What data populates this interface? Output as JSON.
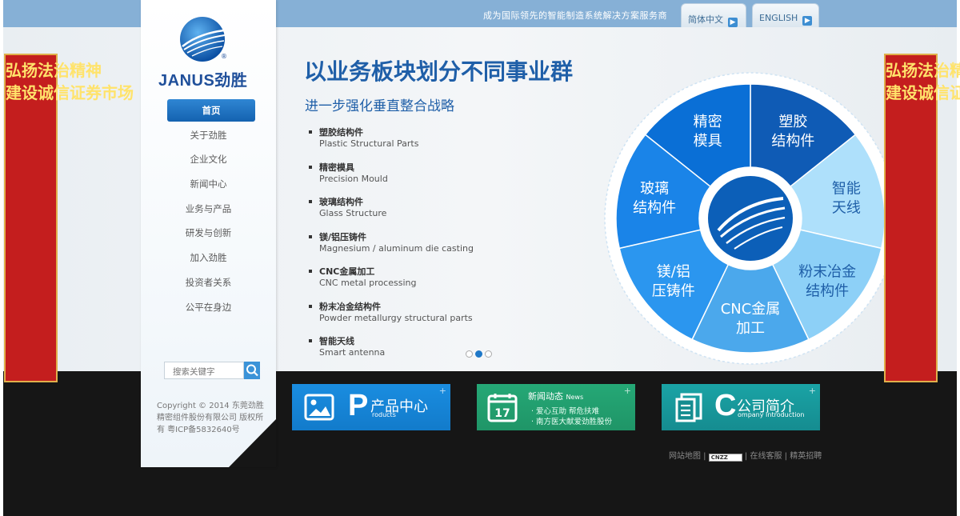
{
  "header": {
    "slogan": "成为国际领先的智能制造系统解决方案服务商",
    "lang_cn": "简体中文",
    "lang_en": "ENGLISH"
  },
  "logo": {
    "text": "JANUS劲胜",
    "registered": "®"
  },
  "nav": {
    "items": [
      {
        "label": "首页"
      },
      {
        "label": "关于劲胜"
      },
      {
        "label": "企业文化"
      },
      {
        "label": "新闻中心"
      },
      {
        "label": "业务与产品"
      },
      {
        "label": "研发与创新"
      },
      {
        "label": "加入劲胜"
      },
      {
        "label": "投资者关系"
      },
      {
        "label": "公平在身边"
      }
    ]
  },
  "search": {
    "placeholder": "搜索关键字"
  },
  "copyright": "Copyright © 2014 东莞劲胜精密组件股份有限公司 版权所有 粤ICP备5832640号",
  "content": {
    "headline": "以业务板块划分不同事业群",
    "subhead": "进一步强化垂直整合战略",
    "items": [
      {
        "cn": "塑胶结构件",
        "en": "Plastic Structural Parts"
      },
      {
        "cn": "精密模具",
        "en": "Precision Mould"
      },
      {
        "cn": "玻璃结构件",
        "en": "Glass Structure"
      },
      {
        "cn": "镁/铝压铸件",
        "en": "Magnesium / aluminum die casting"
      },
      {
        "cn": "CNC金属加工",
        "en": "CNC metal processing"
      },
      {
        "cn": "粉末冶金结构件",
        "en": "Powder metallurgy structural parts"
      },
      {
        "cn": "智能天线",
        "en": "Smart antenna"
      }
    ]
  },
  "wheel": {
    "segments": [
      {
        "line1": "塑胶",
        "line2": "结构件",
        "color": "#0f5bb5"
      },
      {
        "line1": "智能",
        "line2": "天线",
        "color": "#aee0fb"
      },
      {
        "line1": "粉末冶金",
        "line2": "结构件",
        "color": "#8dd0f7"
      },
      {
        "line1": "CNC金属",
        "line2": "加工",
        "color": "#4ba8ec"
      },
      {
        "line1": "镁/铝",
        "line2": "压铸件",
        "color": "#2b96ef"
      },
      {
        "line1": "玻璃",
        "line2": "结构件",
        "color": "#1a84e8"
      },
      {
        "line1": "精密",
        "line2": "模具",
        "color": "#0a6fd6"
      }
    ]
  },
  "banner": {
    "left": "弘扬法治精神\n建设诚信证券市场",
    "right": "弘扬法治精神\n建设诚信证券市场"
  },
  "blocks": {
    "products": {
      "letter": "P",
      "cn": "产品中心",
      "en": "roducts"
    },
    "news": {
      "title": "新闻动态",
      "title_en": "News",
      "line1": "· 爱心互助  帮危扶难",
      "line2": "· 南方医大献爱劲胜股份"
    },
    "about": {
      "letter": "C",
      "cn": "公司简介",
      "en": "ompany Introduction"
    }
  },
  "footer": {
    "sitemap": "网站地图",
    "cnzz": "CNZZ",
    "service": "在线客服",
    "jobs": "精英招聘"
  }
}
